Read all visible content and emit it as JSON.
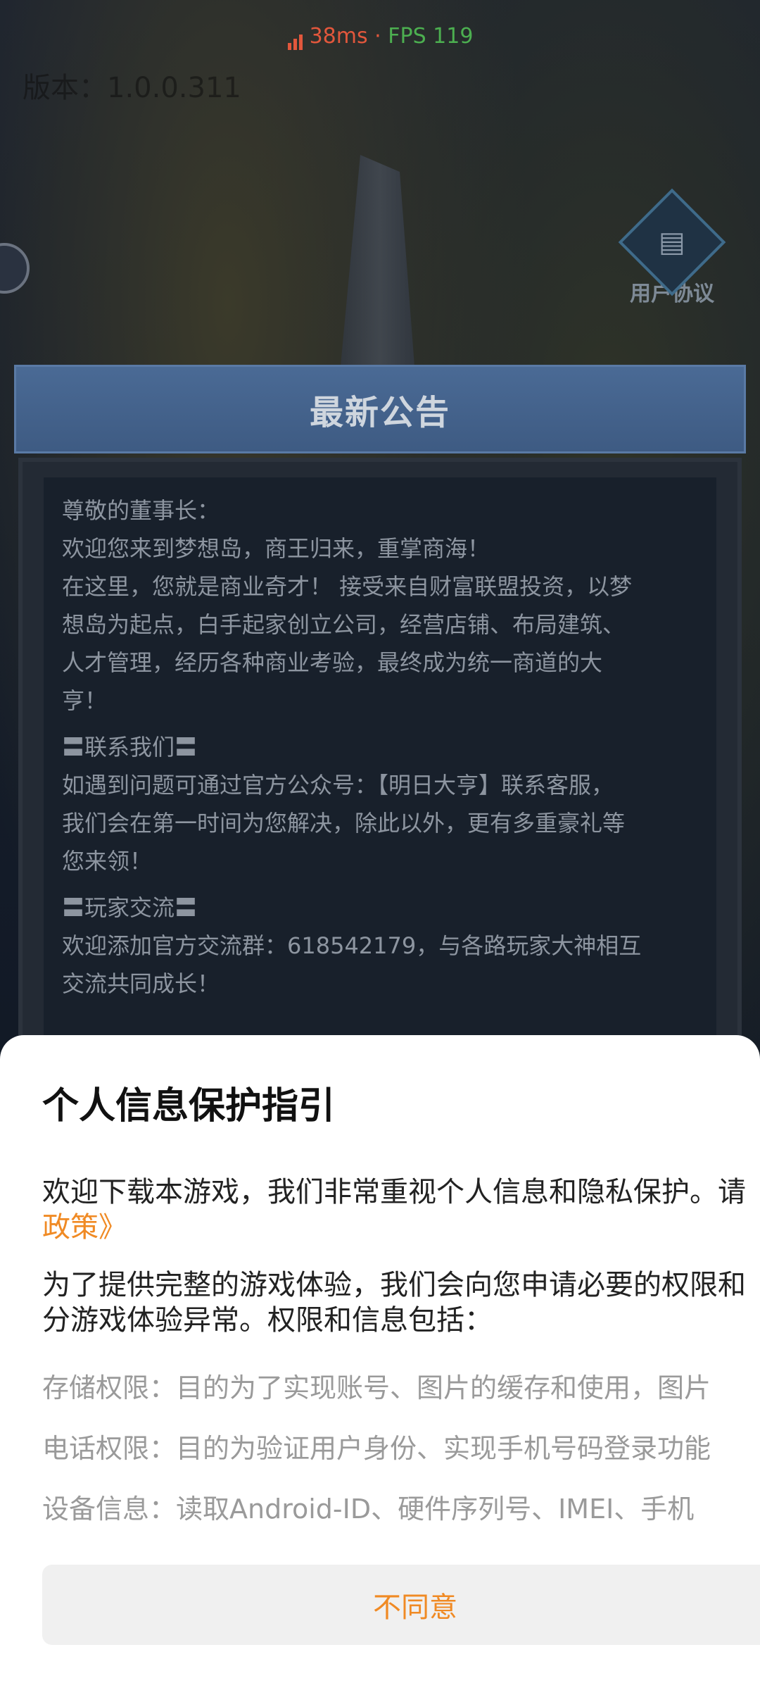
{
  "status_bar": {
    "latency": "38ms",
    "separator": " · ",
    "fps": "FPS 119"
  },
  "version_text": "版本：1.0.0.311",
  "side_icons": {
    "user_agreement_label": "用户协议"
  },
  "notice": {
    "title": "最新公告",
    "greeting": "尊敬的董事长：",
    "welcome": "欢迎您来到梦想岛，商王归来，重掌商海！",
    "intro_lines": [
      "在这里，您就是商业奇才！ 接受来自财富联盟投资，以梦",
      "想岛为起点，白手起家创立公司，经营店铺、布局建筑、",
      "人才管理，经历各种商业考验，最终成为统一商道的大",
      "亨！"
    ],
    "contact_heading": "〓联系我们〓",
    "contact_lines": [
      "如遇到问题可通过官方公众号：【明日大亨】联系客服，",
      "我们会在第一时间为您解决，除此以外，更有多重豪礼等",
      "您来领！"
    ],
    "community_heading": "〓玩家交流〓",
    "community_lines": [
      "欢迎添加官方交流群：618542179，与各路玩家大神相互",
      "交流共同成长！"
    ]
  },
  "privacy": {
    "title": "个人信息保护指引",
    "para1_line1": "欢迎下载本游戏，我们非常重视个人信息和隐私保护。请",
    "para1_link": "政策》",
    "para2_line1": "为了提供完整的游戏体验，我们会向您申请必要的权限和",
    "para2_line2": "分游戏体验异常。权限和信息包括：",
    "permissions": [
      "存储权限：目的为了实现账号、图片的缓存和使用，图片",
      "电话权限：目的为验证用户身份、实现手机号码登录功能",
      "设备信息：读取Android-ID、硬件序列号、IMEI、手机"
    ],
    "disagree_label": "不同意"
  },
  "colors": {
    "accent_orange": "#f08a24",
    "latency_red": "#e2573c",
    "fps_green": "#4caf50"
  }
}
